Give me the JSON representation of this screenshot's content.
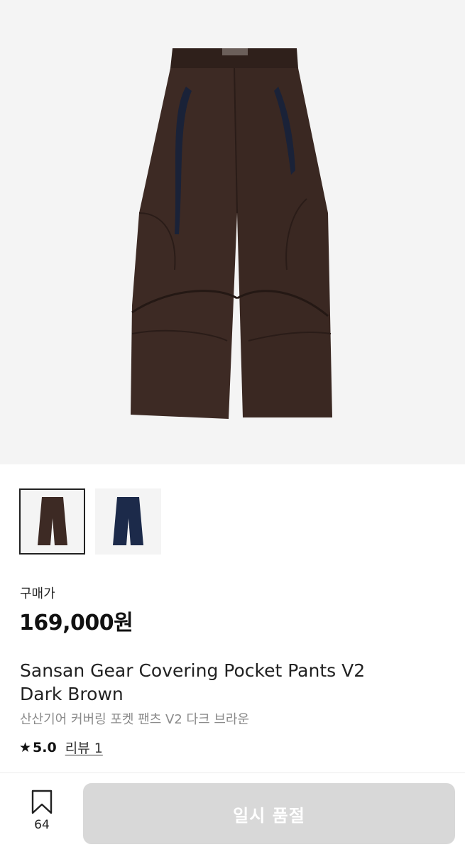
{
  "product": {
    "image_icon": "pants-dark-brown-image",
    "main_color": "#3d2a24",
    "alt_color": "#1c2a4a",
    "thumbnails": [
      {
        "name": "dark-brown",
        "color": "#3d2a24",
        "selected": true
      },
      {
        "name": "navy",
        "color": "#1c2a4a",
        "selected": false
      }
    ],
    "price_label": "구매가",
    "price": "169,000원",
    "title_en_line1": "Sansan Gear Covering Pocket Pants V2",
    "title_en_line2": "Dark Brown",
    "title_ko": "산산기어 커버링 포켓 팬츠 V2 다크 브라운",
    "rating_icon": "star-icon",
    "rating": "5.0",
    "review_link": "리뷰 1"
  },
  "bottom_bar": {
    "bookmark_icon": "bookmark-icon",
    "bookmark_count": "64",
    "soldout_label": "일시 품절",
    "soldout_color": "#d8d8d8"
  }
}
